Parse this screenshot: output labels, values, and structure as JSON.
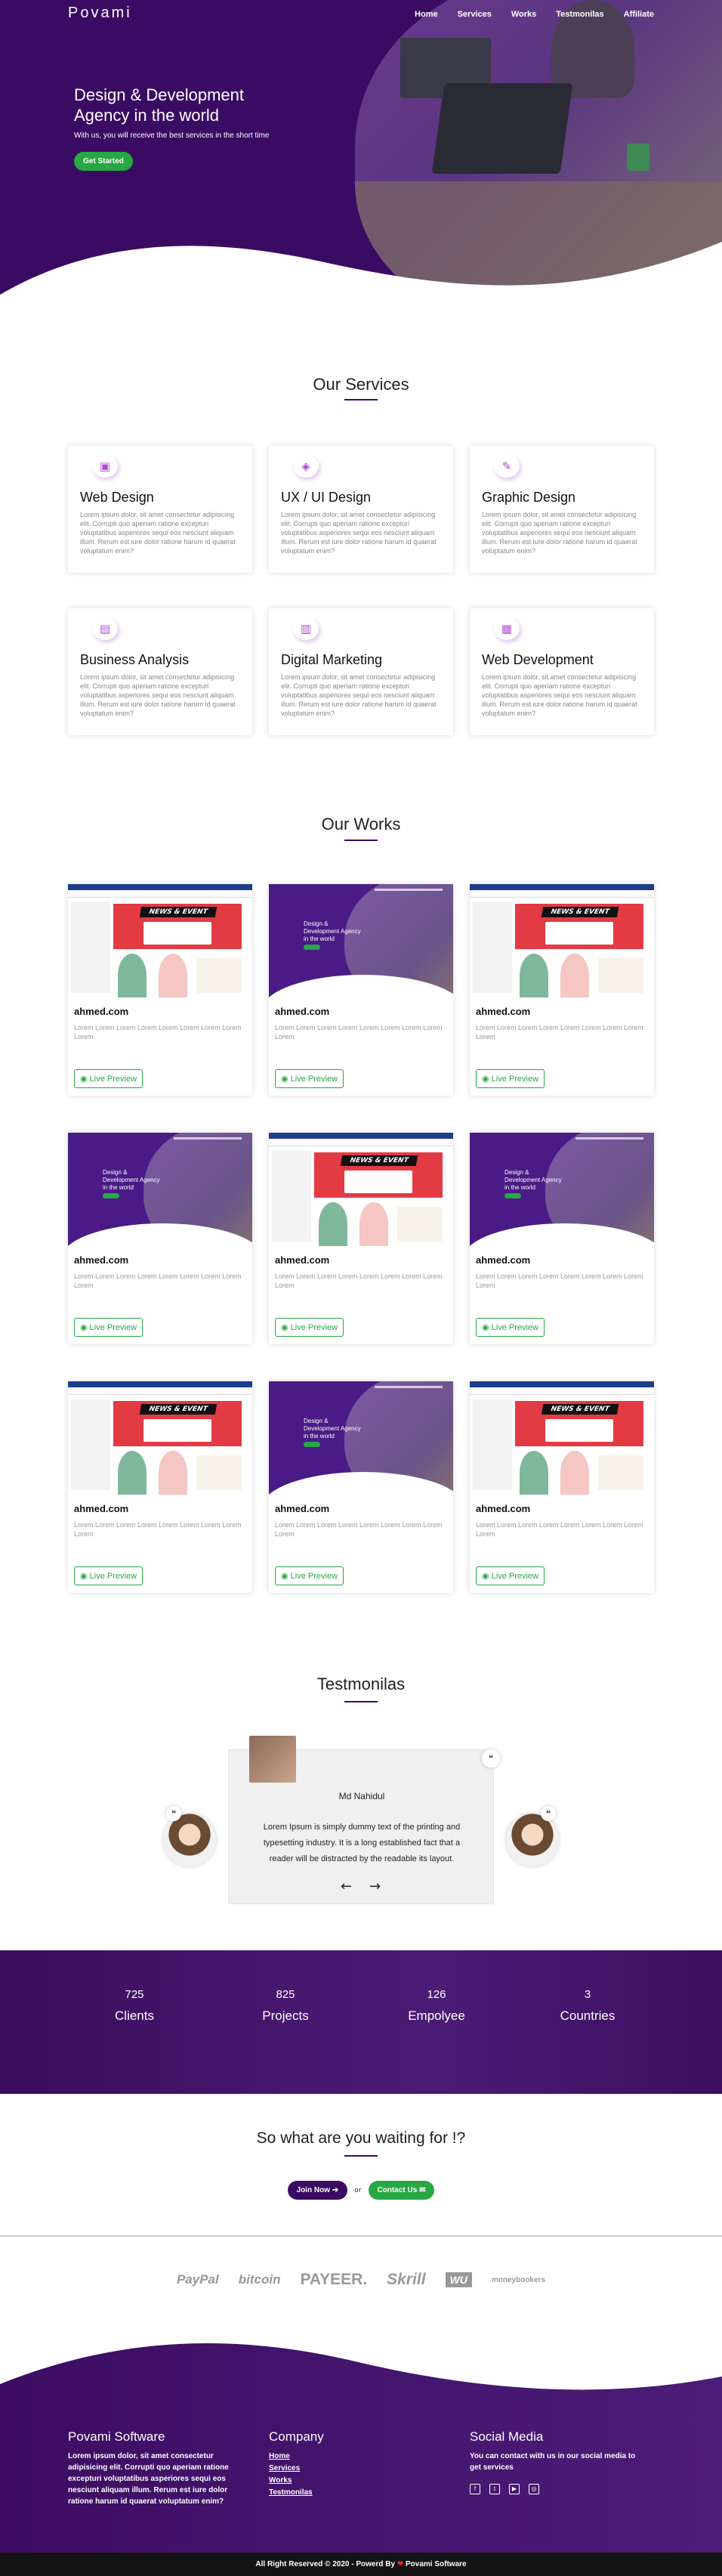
{
  "brand": {
    "logo": "Povami",
    "accent": "#3a0b63",
    "green": "#28a745"
  },
  "nav": {
    "items": [
      "Home",
      "Services",
      "Works",
      "Testmonilas",
      "Affiliate"
    ]
  },
  "hero": {
    "title": "Design & Development Agency in the world",
    "subtitle": "With us, you will receive the best services in the short time",
    "cta": "Get Started"
  },
  "services": {
    "title": "Our Services",
    "items": [
      {
        "name": "Web Design",
        "icon": "web-design-icon",
        "glyph": "▣",
        "text": "Lorem ipsum dolor, sit amet consectetur adipisicing elit. Corrupti quo aperiam ratione excepturi voluptatibus asperiores sequi eos nesciunt aliquam illum. Rerum est iure dolor ratione harum id quaerat voluptatum enim?"
      },
      {
        "name": "UX / UI Design",
        "icon": "ux-ui-design-icon",
        "glyph": "◈",
        "text": "Lorem ipsum dolor, sit amet consectetur adipisicing elit. Corrupti quo aperiam ratione excepturi voluptatibus asperiores sequi eos nesciunt aliquam illum. Rerum est iure dolor ratione harum id quaerat voluptatum enim?"
      },
      {
        "name": "Graphic Design",
        "icon": "graphic-design-icon",
        "glyph": "✎",
        "text": "Lorem ipsum dolor, sit amet consectetur adipisicing elit. Corrupti quo aperiam ratione excepturi voluptatibus asperiores sequi eos nesciunt aliquam illum. Rerum est iure dolor ratione harum id quaerat voluptatum enim?"
      },
      {
        "name": "Business Analysis",
        "icon": "business-analysis-icon",
        "glyph": "▤",
        "text": "Lorem ipsum dolor, sit amet consectetur adipisicing elit. Corrupti quo aperiam ratione excepturi voluptatibus asperiores sequi eos nesciunt aliquam illum. Rerum est iure dolor ratione harum id quaerat voluptatum enim?"
      },
      {
        "name": "Digital Marketing",
        "icon": "digital-marketing-icon",
        "glyph": "▥",
        "text": "Lorem ipsum dolor, sit amet consectetur adipisicing elit. Corrupti quo aperiam ratione excepturi voluptatibus asperiores sequi eos nesciunt aliquam illum. Rerum est iure dolor ratione harum id quaerat voluptatum enim?"
      },
      {
        "name": "Web Development",
        "icon": "web-development-icon",
        "glyph": "▦",
        "text": "Lorem ipsum dolor, sit amet consectetur adipisicing elit. Corrupti quo aperiam ratione excepturi voluptatibus asperiores sequi eos nesciunt aliquam illum. Rerum est iure dolor ratione harum id quaerat voluptatum enim?"
      }
    ]
  },
  "works": {
    "title": "Our Works",
    "badge": "NEWS & EVENT",
    "thumb_text": "Design & Development Agency in the world",
    "items": [
      {
        "kind": "a",
        "name": "ahmed.com",
        "text": "Lorem Lorem Lorem Lorem Lorem Lorem Lorem Lorem Lorem",
        "button": "Live Preview"
      },
      {
        "kind": "b",
        "name": "ahmed.com",
        "text": "Lorem Lorem Lorem Lorem Lorem Lorem Lorem Lorem Lorem",
        "button": "Live Preview"
      },
      {
        "kind": "a",
        "name": "ahmed.com",
        "text": "Lorem Lorem Lorem Lorem Lorem Lorem Lorem Lorem Lorem",
        "button": "Live Preview"
      },
      {
        "kind": "b",
        "name": "ahmed.com",
        "text": "Lorem Lorem Lorem Lorem Lorem Lorem Lorem Lorem Lorem",
        "button": "Live Preview"
      },
      {
        "kind": "a",
        "name": "ahmed.com",
        "text": "Lorem Lorem Lorem Lorem Lorem Lorem Lorem Lorem Lorem",
        "button": "Live Preview"
      },
      {
        "kind": "b",
        "name": "ahmed.com",
        "text": "Lorem Lorem Lorem Lorem Lorem Lorem Lorem Lorem Lorem",
        "button": "Live Preview"
      },
      {
        "kind": "a",
        "name": "ahmed.com",
        "text": "Lorem Lorem Lorem Lorem Lorem Lorem Lorem Lorem Lorem",
        "button": "Live Preview"
      },
      {
        "kind": "b",
        "name": "ahmed.com",
        "text": "Lorem Lorem Lorem Lorem Lorem Lorem Lorem Lorem Lorem",
        "button": "Live Preview"
      },
      {
        "kind": "a",
        "name": "ahmed.com",
        "text": "Lorem Lorem Lorem Lorem Lorem Lorem Lorem Lorem Lorem",
        "button": "Live Preview"
      }
    ]
  },
  "testimonials": {
    "title": "Testmonilas",
    "name": "Md Nahidul",
    "text": "Lorem Ipsum is simply dummy text of the printing and typesetting industry. It is a long established fact that a reader will be distracted by the readable its layout.",
    "prev": "←",
    "next": "→"
  },
  "stats": [
    {
      "value": "725",
      "label": "Clients"
    },
    {
      "value": "825",
      "label": "Projects"
    },
    {
      "value": "126",
      "label": "Empolyee"
    },
    {
      "value": "3",
      "label": "Countries"
    }
  ],
  "cta": {
    "title": "So what are you waiting for !?",
    "join": "Join Now ➜",
    "or": "or",
    "contact": "Contact Us ✉"
  },
  "brands": [
    "PayPal",
    "bitcoin",
    "PAYEER.",
    "Skrill",
    "WU",
    "moneybookers"
  ],
  "footer": {
    "about_title": "Povami Software",
    "about_text": "Lorem ipsum dolor, sit amet consectetur adipisicing elit. Corrupti quo aperiam ratione excepturi voluptatibus asperiores sequi eos nesciunt aliquam illum. Rerum est iure dolor ratione harum id quaerat voluptatum enim?",
    "company_title": "Company",
    "links": [
      "Home",
      "Services",
      "Works",
      "Testmonilas"
    ],
    "social_title": "Social Media",
    "social_text": "You can contact with us in our social media to get services",
    "social": [
      {
        "icon": "facebook-icon",
        "glyph": "f"
      },
      {
        "icon": "twitter-icon",
        "glyph": "t"
      },
      {
        "icon": "youtube-icon",
        "glyph": "▶"
      },
      {
        "icon": "instagram-icon",
        "glyph": "◎"
      }
    ]
  },
  "copyright": {
    "text": "All Right Reserved © 2020 - Powerd By",
    "heart": "❤",
    "brand": "Povami Software"
  }
}
